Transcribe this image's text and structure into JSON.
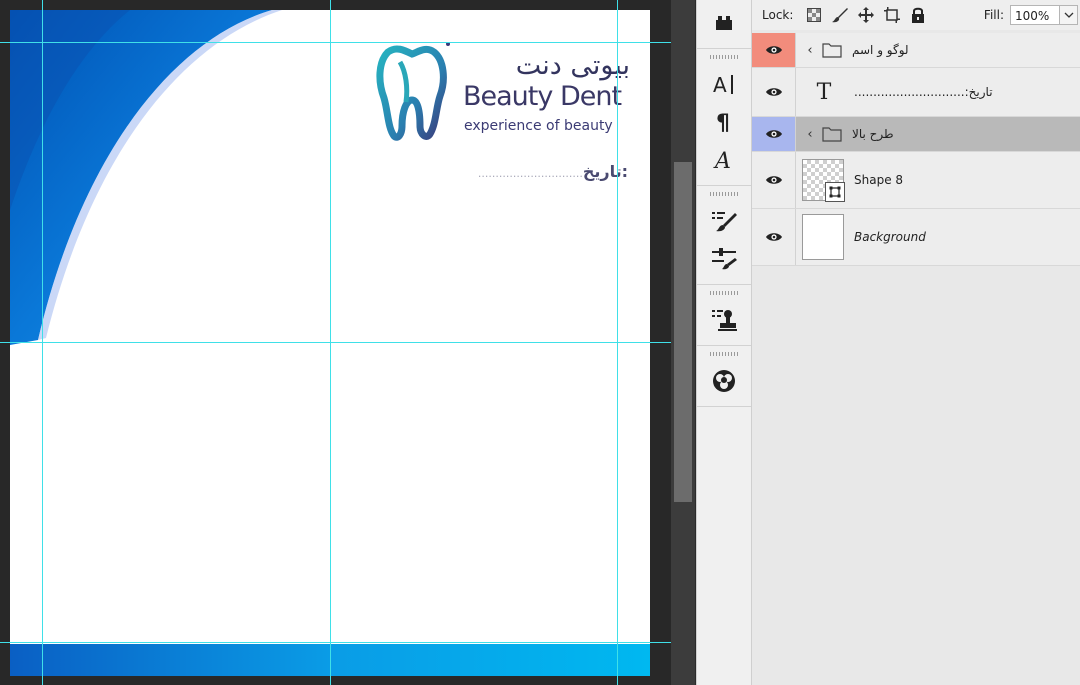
{
  "document": {
    "logo": {
      "name_fa": "بیوتی دنت",
      "name_en": "Beauty Dent",
      "tagline": "experience of beauty"
    },
    "date_label": "تاریخ:",
    "date_dots": "..............................",
    "colors": {
      "brand_blue": "#0a6fd0",
      "brand_cyan": "#00b4ee",
      "logo_teal": "#2aa7b8",
      "logo_navy": "#33345e",
      "guide": "#3fe0e8"
    }
  },
  "tools": [
    {
      "name": "clone-source-icon"
    },
    {
      "name": "character-panel-icon"
    },
    {
      "name": "paragraph-panel-icon"
    },
    {
      "name": "glyphs-panel-icon"
    },
    {
      "name": "brush-presets-icon"
    },
    {
      "name": "brush-settings-icon"
    },
    {
      "name": "tool-presets-icon"
    },
    {
      "name": "3d-materials-icon"
    }
  ],
  "layers_panel": {
    "lock_label": "Lock:",
    "fill_label": "Fill:",
    "fill_value": "100%",
    "layers": [
      {
        "name": "لوگو و اسم",
        "kind": "group",
        "eye_color": "red"
      },
      {
        "name": ".............................:تاریخ",
        "kind": "text"
      },
      {
        "name": "طرح بالا",
        "kind": "group",
        "eye_color": "blue",
        "selected": true
      },
      {
        "name": "Shape 8",
        "kind": "shape"
      },
      {
        "name": "Background",
        "kind": "background"
      }
    ]
  }
}
